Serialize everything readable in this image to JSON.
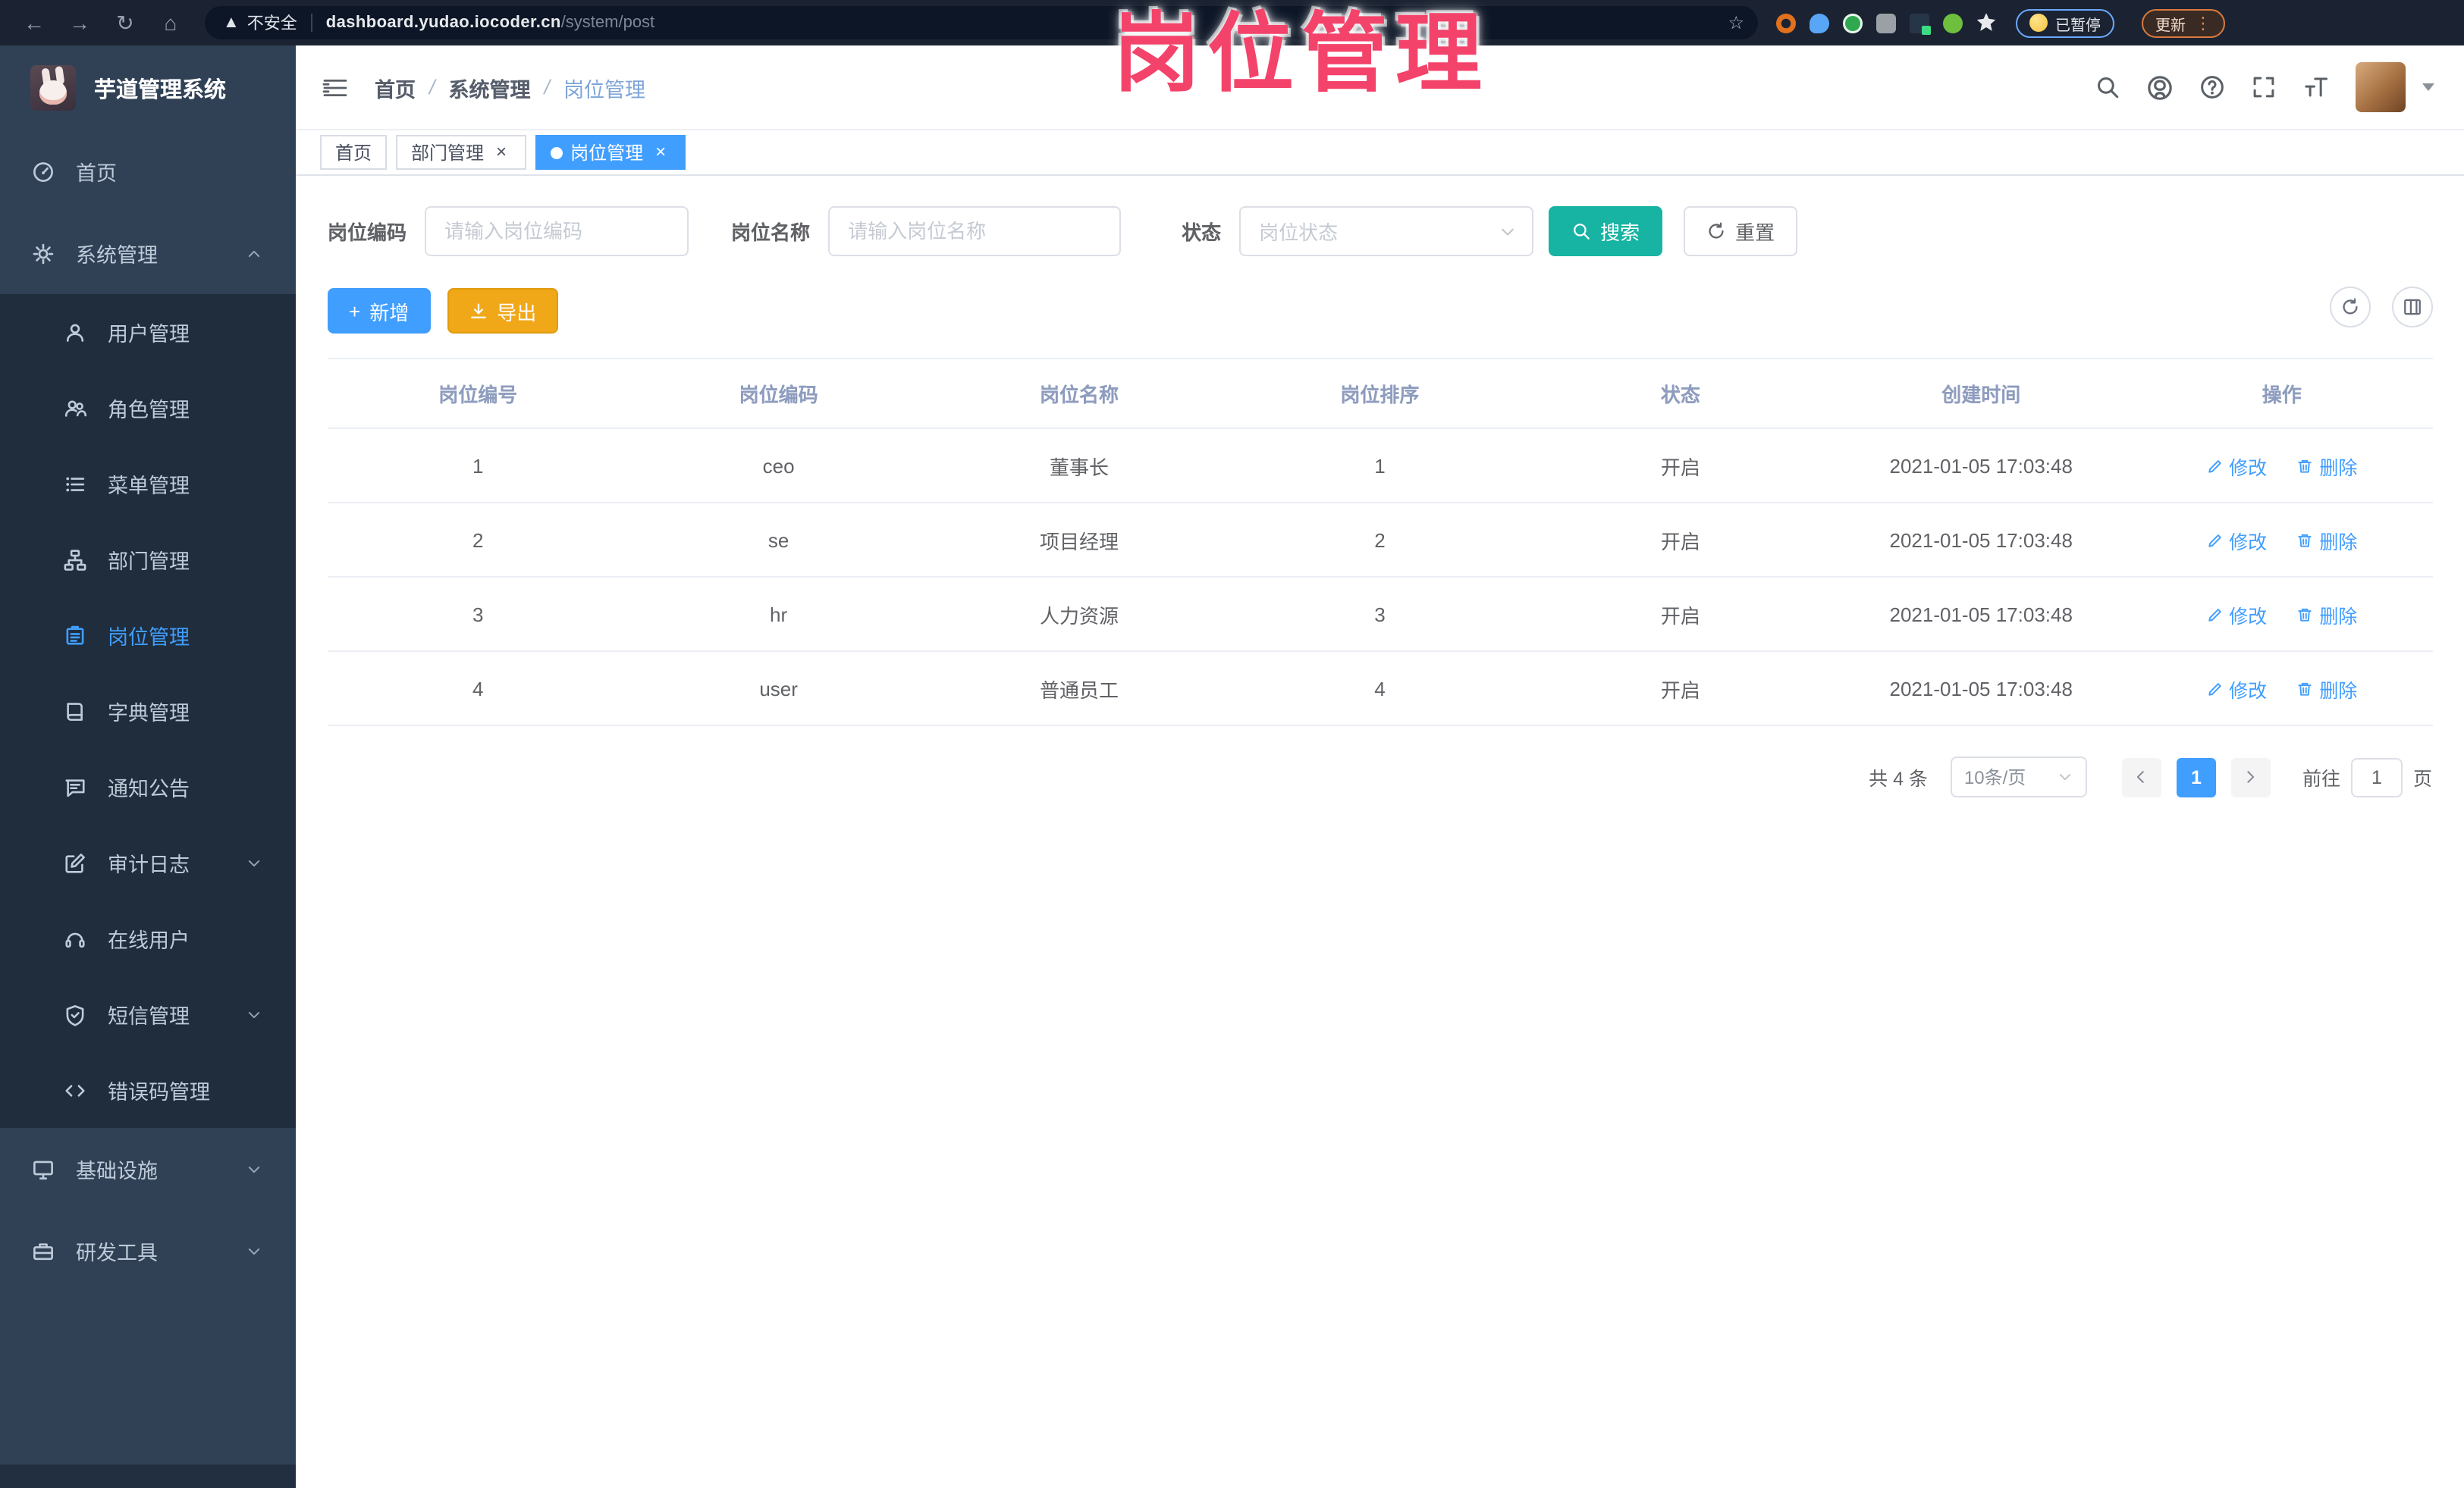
{
  "annotation": {
    "text": "岗位管理",
    "color": "#f4436a"
  },
  "browser": {
    "security_label": "不安全",
    "url_host": "dashboard.yudao.iocoder.cn",
    "url_path": "/system/post",
    "paused_label": "已暂停",
    "update_label": "更新"
  },
  "colors": {
    "accent_blue": "#409eff",
    "search_teal": "#17b3a3",
    "export_orange": "#f0a718",
    "sidebar_bg": "#304156",
    "submenu_bg": "#1f2d3d"
  },
  "sidebar": {
    "app_title": "芋道管理系统",
    "items": [
      {
        "label": "首页",
        "icon": "home-icon",
        "type": "top"
      },
      {
        "label": "系统管理",
        "icon": "gear-icon",
        "type": "top",
        "arrow": "up"
      },
      {
        "label": "用户管理",
        "icon": "user-icon",
        "type": "sub"
      },
      {
        "label": "角色管理",
        "icon": "roles-icon",
        "type": "sub"
      },
      {
        "label": "菜单管理",
        "icon": "menu-icon",
        "type": "sub"
      },
      {
        "label": "部门管理",
        "icon": "dept-icon",
        "type": "sub"
      },
      {
        "label": "岗位管理",
        "icon": "post-icon",
        "type": "sub",
        "active": true
      },
      {
        "label": "字典管理",
        "icon": "dict-icon",
        "type": "sub"
      },
      {
        "label": "通知公告",
        "icon": "notice-icon",
        "type": "sub"
      },
      {
        "label": "审计日志",
        "icon": "audit-icon",
        "type": "sub",
        "arrow": "down"
      },
      {
        "label": "在线用户",
        "icon": "online-icon",
        "type": "sub"
      },
      {
        "label": "短信管理",
        "icon": "sms-icon",
        "type": "sub",
        "arrow": "down"
      },
      {
        "label": "错误码管理",
        "icon": "errcode-icon",
        "type": "sub"
      },
      {
        "label": "基础设施",
        "icon": "infra-icon",
        "type": "top",
        "arrow": "down"
      },
      {
        "label": "研发工具",
        "icon": "devtool-icon",
        "type": "top",
        "arrow": "down"
      }
    ]
  },
  "header": {
    "breadcrumb": [
      {
        "label": "首页"
      },
      {
        "label": "系统管理"
      },
      {
        "label": "岗位管理",
        "current": true
      }
    ]
  },
  "tabs": [
    {
      "label": "首页",
      "closable": false,
      "active": false
    },
    {
      "label": "部门管理",
      "closable": true,
      "active": false
    },
    {
      "label": "岗位管理",
      "closable": true,
      "active": true
    }
  ],
  "filters": {
    "post_code_label": "岗位编码",
    "post_code_placeholder": "请输入岗位编码",
    "post_name_label": "岗位名称",
    "post_name_placeholder": "请输入岗位名称",
    "status_label": "状态",
    "status_placeholder": "岗位状态",
    "search_label": "搜索",
    "reset_label": "重置"
  },
  "toolbar": {
    "add_label": "新增",
    "export_label": "导出"
  },
  "table": {
    "columns": [
      "岗位编号",
      "岗位编码",
      "岗位名称",
      "岗位排序",
      "状态",
      "创建时间",
      "操作"
    ],
    "edit_label": "修改",
    "delete_label": "删除",
    "rows": [
      {
        "id": "1",
        "code": "ceo",
        "name": "董事长",
        "sort": "1",
        "status": "开启",
        "created": "2021-01-05 17:03:48"
      },
      {
        "id": "2",
        "code": "se",
        "name": "项目经理",
        "sort": "2",
        "status": "开启",
        "created": "2021-01-05 17:03:48"
      },
      {
        "id": "3",
        "code": "hr",
        "name": "人力资源",
        "sort": "3",
        "status": "开启",
        "created": "2021-01-05 17:03:48"
      },
      {
        "id": "4",
        "code": "user",
        "name": "普通员工",
        "sort": "4",
        "status": "开启",
        "created": "2021-01-05 17:03:48"
      }
    ]
  },
  "pagination": {
    "total": "共 4 条",
    "page_size": "10条/页",
    "current_page": "1",
    "goto_label": "前往",
    "goto_value": "1",
    "page_label": "页"
  }
}
